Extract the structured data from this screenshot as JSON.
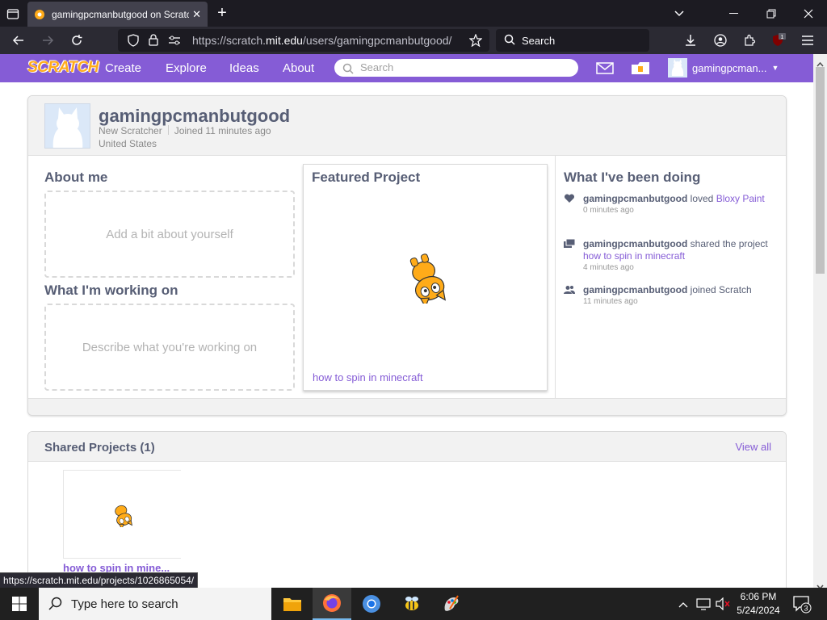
{
  "browser": {
    "tab_title": "gamingpcmanbutgood on Scratch",
    "url_prefix": "https://scratch.",
    "url_domain": "mit.edu",
    "url_path": "/users/gamingpcmanbutgood/",
    "search_placeholder": "Search",
    "extension_badge": "1"
  },
  "scratch_header": {
    "logo": "SCRATCH",
    "nav": [
      "Create",
      "Explore",
      "Ideas",
      "About"
    ],
    "search_placeholder": "Search",
    "username_short": "gamingpcman...",
    "accent": "#855cd6"
  },
  "profile": {
    "username": "gamingpcmanbutgood",
    "rank": "New Scratcher",
    "joined": "Joined 11 minutes ago",
    "location": "United States",
    "about_title": "About me",
    "about_placeholder": "Add a bit about yourself",
    "working_title": "What I'm working on",
    "working_placeholder": "Describe what you're working on",
    "featured_title": "Featured Project",
    "featured_project": "how to spin in minecraft",
    "activity_title": "What I've been doing",
    "activity": [
      {
        "icon": "heart-icon",
        "user": "gamingpcmanbutgood",
        "action": " loved ",
        "target": "Bloxy Paint",
        "time": "0 minutes ago"
      },
      {
        "icon": "share-icon",
        "user": "gamingpcmanbutgood",
        "action": " shared the project ",
        "target": "how to spin in minecraft",
        "time": "4 minutes ago"
      },
      {
        "icon": "people-icon",
        "user": "gamingpcmanbutgood",
        "action": " joined Scratch",
        "target": "",
        "time": "11 minutes ago"
      }
    ]
  },
  "shared": {
    "title": "Shared Projects (1)",
    "view_all": "View all",
    "project_title": "how to spin in mine..."
  },
  "status_url": "https://scratch.mit.edu/projects/1026865054/",
  "taskbar": {
    "search_placeholder": "Type here to search",
    "time": "6:06 PM",
    "date": "5/24/2024",
    "notification_count": "3"
  }
}
